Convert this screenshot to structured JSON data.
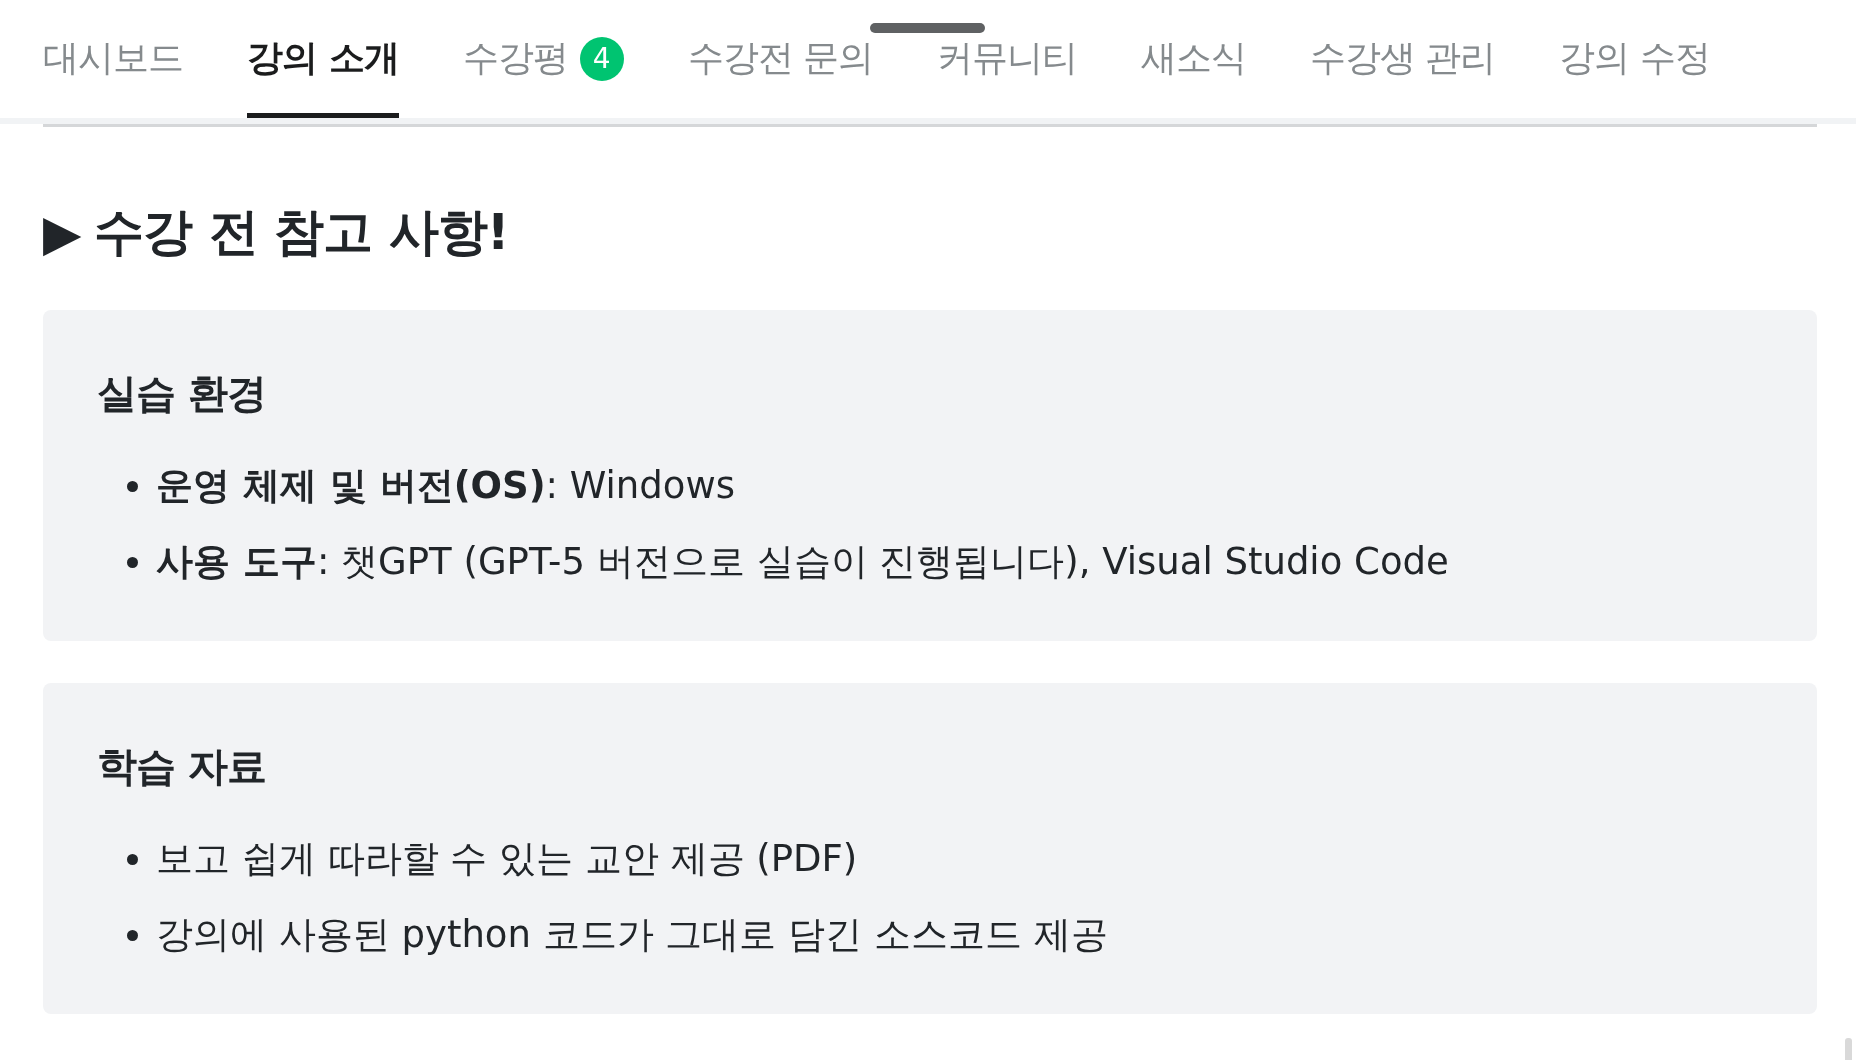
{
  "tabs": [
    {
      "label": "대시보드",
      "selected": false
    },
    {
      "label": "강의 소개",
      "selected": true
    },
    {
      "label": "수강평",
      "selected": false,
      "badge": "4"
    },
    {
      "label": "수강전 문의",
      "selected": false
    },
    {
      "label": "커뮤니티",
      "selected": false
    },
    {
      "label": "새소식",
      "selected": false
    },
    {
      "label": "수강생 관리",
      "selected": false
    },
    {
      "label": "강의 수정",
      "selected": false
    }
  ],
  "section_title": {
    "marker": "▶",
    "text": "수강 전 참고 사항!"
  },
  "cards": [
    {
      "title": "실습 환경",
      "items": [
        "**운영 체제 및 버전(OS)**: Windows",
        "**사용 도구**: 챗GPT (GPT-5 버전으로 실습이 진행됩니다), Visual Studio Code"
      ]
    },
    {
      "title": "학습 자료",
      "items": [
        "보고 쉽게 따라할 수 있는 교안 제공 (PDF)",
        "강의에 사용된 python 코드가 그대로 담긴 소스코드 제공"
      ]
    }
  ]
}
